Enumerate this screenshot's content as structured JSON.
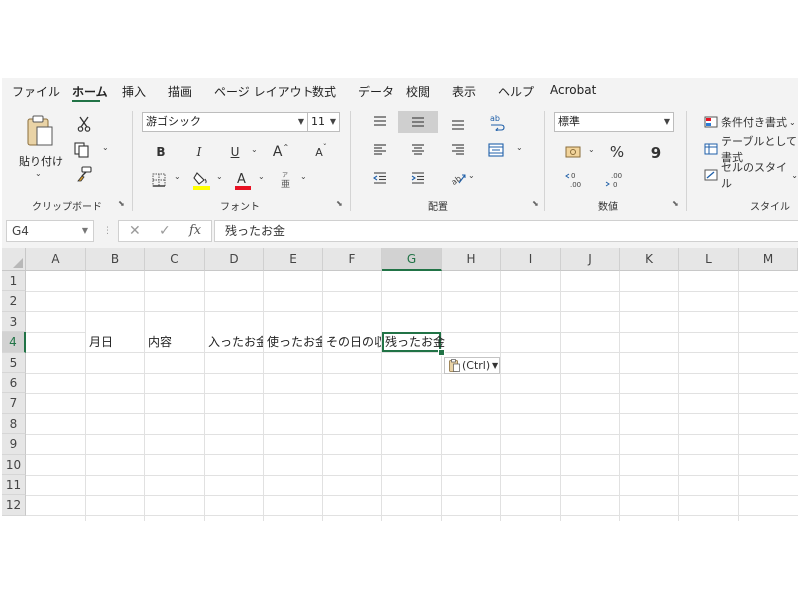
{
  "tabs": [
    {
      "label": "ファイル",
      "active": false
    },
    {
      "label": "ホーム",
      "active": true
    },
    {
      "label": "挿入",
      "active": false
    },
    {
      "label": "描画",
      "active": false
    },
    {
      "label": "ページ レイアウト",
      "active": false
    },
    {
      "label": "数式",
      "active": false
    },
    {
      "label": "データ",
      "active": false
    },
    {
      "label": "校閲",
      "active": false
    },
    {
      "label": "表示",
      "active": false
    },
    {
      "label": "ヘルプ",
      "active": false
    },
    {
      "label": "Acrobat",
      "active": false
    }
  ],
  "ribbon": {
    "clipboard": {
      "paste_label": "貼り付け",
      "group_label": "クリップボード"
    },
    "font": {
      "font_name": "游ゴシック",
      "font_size": "11",
      "bold_label": "B",
      "italic_label": "I",
      "underline_label": "U",
      "grow_label": "A",
      "shrink_label": "A",
      "group_label": "フォント",
      "highlight_color": "#ffff00",
      "font_color": "#e81123"
    },
    "alignment": {
      "group_label": "配置",
      "selected": "align-middle"
    },
    "number": {
      "format": "標準",
      "percent_label": "%",
      "comma_label": "9",
      "group_label": "数値"
    },
    "styles": {
      "conditional_label": "条件付き書式",
      "table_label": "テーブルとして書式",
      "cell_styles_label": "セルのスタイル",
      "group_label": "スタイル"
    }
  },
  "formula_bar": {
    "name_box": "G4",
    "fx_label": "fx",
    "content": "残ったお金"
  },
  "sheet": {
    "columns": [
      "A",
      "B",
      "C",
      "D",
      "E",
      "F",
      "G",
      "H",
      "I",
      "J",
      "K",
      "L",
      "M"
    ],
    "rows": [
      "1",
      "2",
      "3",
      "4",
      "5",
      "6",
      "7",
      "8",
      "9",
      "10",
      "11",
      "12"
    ],
    "selected_column": "G",
    "selected_row": "4",
    "cells": [
      {
        "ref": "B4",
        "value": "月日"
      },
      {
        "ref": "C4",
        "value": "内容"
      },
      {
        "ref": "D4",
        "value": "入ったお金"
      },
      {
        "ref": "E4",
        "value": "使ったお金"
      },
      {
        "ref": "F4",
        "value": "その日の収支"
      }
    ],
    "active_cell": {
      "ref": "G4",
      "value": "残ったお金"
    },
    "paste_options_label": "(Ctrl)"
  },
  "colors": {
    "accent": "#217346",
    "ribbon_bg": "#f3f3f3",
    "header_bg": "#e6e6e6",
    "gridline": "#e1e1e1"
  }
}
